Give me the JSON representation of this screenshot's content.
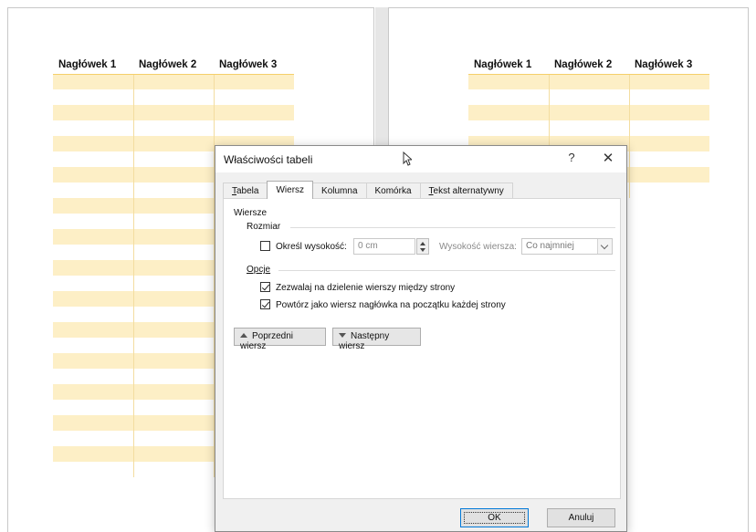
{
  "document": {
    "left_table": {
      "headers": [
        "Nagłówek 1",
        "Nagłówek 2",
        "Nagłówek 3"
      ]
    },
    "right_table": {
      "headers": [
        "Nagłówek 1",
        "Nagłówek 2",
        "Nagłówek 3"
      ]
    },
    "colors": {
      "band": "#fdefc6",
      "header_rule": "#f5cf6a"
    }
  },
  "dialog": {
    "title": "Właściwości tabeli",
    "help_label": "?",
    "close_label": "✕",
    "tabs": [
      {
        "label": "Tabela",
        "underline": "T",
        "rest": "abela",
        "active": false
      },
      {
        "label": "Wiersz",
        "underline": "",
        "rest": "Wiersz",
        "active": true
      },
      {
        "label": "Kolumna",
        "underline": "",
        "rest": "Kolumna",
        "active": false
      },
      {
        "label": "Komórka",
        "underline": "",
        "rest": "Komórka",
        "active": false
      },
      {
        "label": "Tekst alternatywny",
        "underline": "T",
        "rest": "ekst alternatywny",
        "active": false
      }
    ],
    "section_rows": "Wiersze",
    "size_group": "Rozmiar",
    "specify_height": {
      "label": "Określ wysokość:",
      "checked": false
    },
    "height_value": "0 cm",
    "row_height_label": "Wysokość wiersza:",
    "row_height_select": "Co najmniej",
    "options_group": "Opcje",
    "allow_break": {
      "label": "Zezwalaj na dzielenie wierszy między strony",
      "checked": true
    },
    "repeat_header": {
      "label": "Powtórz jako wiersz nagłówka na początku każdej strony",
      "checked": true
    },
    "prev_row": "Poprzedni wiersz",
    "next_row": "Następny wiersz",
    "ok": "OK",
    "cancel": "Anuluj"
  }
}
